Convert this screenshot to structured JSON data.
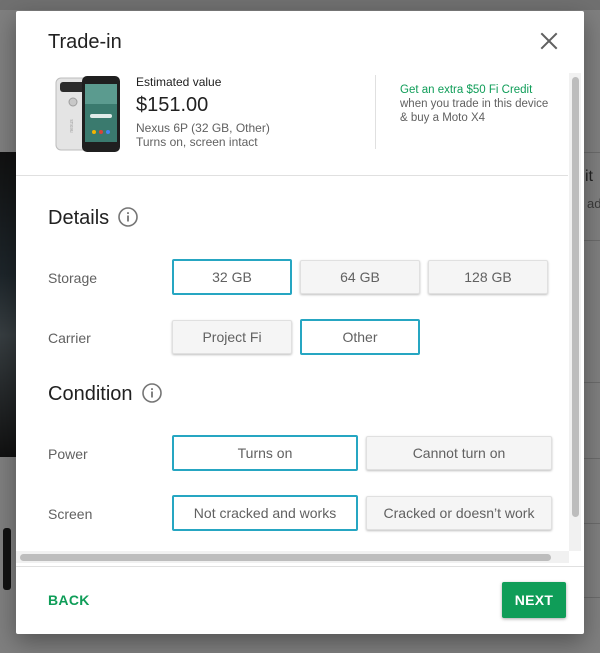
{
  "dialog": {
    "title": "Trade-in",
    "close_icon": "close-icon"
  },
  "summary": {
    "estimated_label": "Estimated value",
    "estimated_value": "$151.00",
    "device_line": "Nexus 6P (32 GB, Other)",
    "condition_line": "Turns on, screen intact",
    "promo_highlight": "Get an extra $50 Fi Credit",
    "promo_line1": "when you trade in this device",
    "promo_line2": "& buy a Moto X4"
  },
  "details": {
    "title": "Details",
    "info_icon": "info-icon",
    "storage": {
      "label": "Storage",
      "options": [
        "32 GB",
        "64 GB",
        "128 GB"
      ],
      "selected": "32 GB"
    },
    "carrier": {
      "label": "Carrier",
      "options": [
        "Project Fi",
        "Other"
      ],
      "selected": "Other"
    }
  },
  "condition": {
    "title": "Condition",
    "info_icon": "info-icon",
    "power": {
      "label": "Power",
      "options": [
        "Turns on",
        "Cannot turn on"
      ],
      "selected": "Turns on"
    },
    "screen": {
      "label": "Screen",
      "options": [
        "Not cracked and works",
        "Cracked or doesn’t work"
      ],
      "selected": "Not cracked and works"
    }
  },
  "footer": {
    "back_label": "BACK",
    "next_label": "NEXT"
  },
  "background": {
    "partial_text": "it",
    "partial_sub": "ade"
  },
  "colors": {
    "accent_green": "#0f9d58",
    "selected_border": "#26a6c2"
  }
}
